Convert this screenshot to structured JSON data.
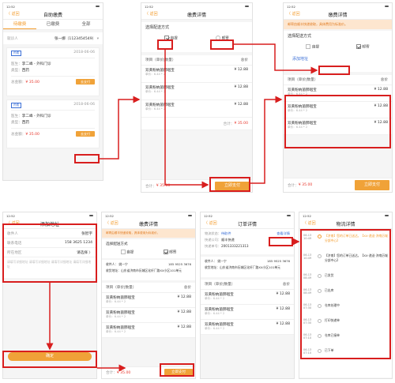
{
  "status_time": "12:52",
  "back_label": "〈 返回",
  "s1": {
    "title": "自助缴费",
    "tabs": [
      "待缴费",
      "已缴费",
      "全部"
    ],
    "patient_label": "就诊人",
    "patient_value": "张一娜（1123454549）",
    "cards": [
      {
        "badge": "药费",
        "date": "2018-06-06",
        "doctor_label": "医生：",
        "doctor": "李二峰 - 外科门诊",
        "type_label": "类型：",
        "type": "西药",
        "total_label": "总金额：",
        "total": "¥ 35.00",
        "btn": "去支付"
      },
      {
        "badge": "药费",
        "date": "2018-06-06",
        "doctor_label": "医生：",
        "doctor": "李二峰 - 外科门诊",
        "type_label": "类型：",
        "type": "西药",
        "total_label": "总金额：",
        "total": "¥ 35.00",
        "btn": "去支付"
      }
    ]
  },
  "s2": {
    "title": "缴费详情",
    "delivery_label": "选择配送方式",
    "opt_pickup": "自提",
    "opt_mail": "邮寄",
    "col_item": "项目（单价|数量）",
    "col_total": "总价",
    "items": [
      {
        "name": "双黄粉纳菌肺咽宝",
        "sub": "单价：6.44 * 2",
        "price": "¥ 12.88"
      },
      {
        "name": "双黄粉纳菌肺咽宝",
        "sub": "单价：6.44 * 2",
        "price": "¥ 12.88"
      },
      {
        "name": "双黄粉纳菌肺咽宝",
        "sub": "单价：6.44 * 2",
        "price": "¥ 12.88"
      }
    ],
    "sum_label": "合计：",
    "sum_value": "¥ 35.00",
    "pay_btn": "立即支付"
  },
  "s3": {
    "title": "缴费详情",
    "notice": "邮寄由顺丰快递收取，具体费用为标准价。",
    "delivery_label": "选择配送方式",
    "opt_pickup": "自提",
    "opt_mail": "邮寄",
    "add_address": "添加地址",
    "col_item": "项目（单价|数量）",
    "col_total": "总价",
    "items": [
      {
        "name": "双黄粉纳菌肺咽宝",
        "sub": "单价：6.44 * 2",
        "price": "¥ 12.88"
      },
      {
        "name": "双黄粉纳菌肺咽宝",
        "sub": "单价：6.44 * 2",
        "price": "¥ 12.88"
      },
      {
        "name": "双黄粉纳菌肺咽宝",
        "sub": "单价：6.44 * 2",
        "price": "¥ 12.88"
      }
    ],
    "sum_label": "合计：",
    "sum_value": "¥ 35.00",
    "pay_btn": "立即支付"
  },
  "s4": {
    "title": "添加地址",
    "name_label": "收件人",
    "name_value": "张智宇",
    "phone_label": "联系电话",
    "phone_value": "158 3625 1234",
    "region_label": "所在地区",
    "region_value": "请选择 〉",
    "detail_placeholder": "请填写详细地址 请填写详细地址 请填写详细地址 请填写详细地址",
    "confirm_btn": "确定"
  },
  "s5": {
    "title": "缴费详情",
    "notice": "邮寄由顺丰快递收取，具体费用为标准价。",
    "delivery_label": "选择配送方式",
    "opt_pickup": "自提",
    "opt_mail": "邮寄",
    "recv_name": "收件人：   姚一宁",
    "recv_phone": "185 9525 3676",
    "recv_addr": "收货地址：山东省济南市历城区化纤厂路XX小区101单元",
    "col_item": "项目（单价|数量）",
    "col_total": "总价",
    "items": [
      {
        "name": "双黄粉纳菌肺咽宝",
        "sub": "单价：6.44 * 2",
        "price": "¥ 12.88"
      },
      {
        "name": "双黄粉纳菌肺咽宝",
        "sub": "单价：6.44 * 2",
        "price": "¥ 12.88"
      },
      {
        "name": "双黄粉纳菌肺咽宝",
        "sub": "单价：6.44 * 2",
        "price": "¥ 12.88"
      }
    ],
    "sum_label": "合计：",
    "sum_value": "¥ 35.00",
    "pay_btn": "立即支付"
  },
  "s6": {
    "title": "订单详情",
    "status_label": "物流状态：",
    "status_value": "待取件",
    "courier_label": "快递公司：",
    "courier_value": "顺丰快递",
    "no_label": "快递单号：",
    "no_value": "2001333221313",
    "track_link": "查看详情",
    "recv_name": "收件人：   姚一宁",
    "recv_phone": "185 9525 3676",
    "recv_addr": "收货地址：山东省济南市历城区化纤厂路XX小区101单元",
    "col_item": "项目（单价|数量）",
    "col_total": "总价",
    "items": [
      {
        "name": "双黄粉纳菌肺咽宝",
        "sub": "单价：6.44 * 2",
        "price": "¥ 12.88"
      },
      {
        "name": "双黄粉纳菌肺咽宝",
        "sub": "单价：6.44 * 2",
        "price": "¥ 12.88"
      },
      {
        "name": "双黄粉纳菌肺咽宝",
        "sub": "单价：6.44 * 2",
        "price": "¥ 12.88"
      }
    ]
  },
  "s7": {
    "title": "物流详情",
    "events": [
      {
        "date": "06-13 10:49",
        "text": "【济南】您的订单已送达，【XX·递送·济南历城分部中心】"
      },
      {
        "date": "06-13 10:49",
        "text": "【济南】您的订单已送达，【XX·递送·济南历城分部中心】"
      },
      {
        "date": "06-13 08:49",
        "text": "已发货"
      },
      {
        "date": "06-13 08:49",
        "text": "已出库"
      },
      {
        "date": "06-13 07:30",
        "text": "仓库处理中"
      },
      {
        "date": "06-13 07:30",
        "text": "打印快递单"
      },
      {
        "date": "06-13 07:10",
        "text": "仓库已接单"
      },
      {
        "date": "06-13 07:10",
        "text": "已下单"
      }
    ]
  }
}
